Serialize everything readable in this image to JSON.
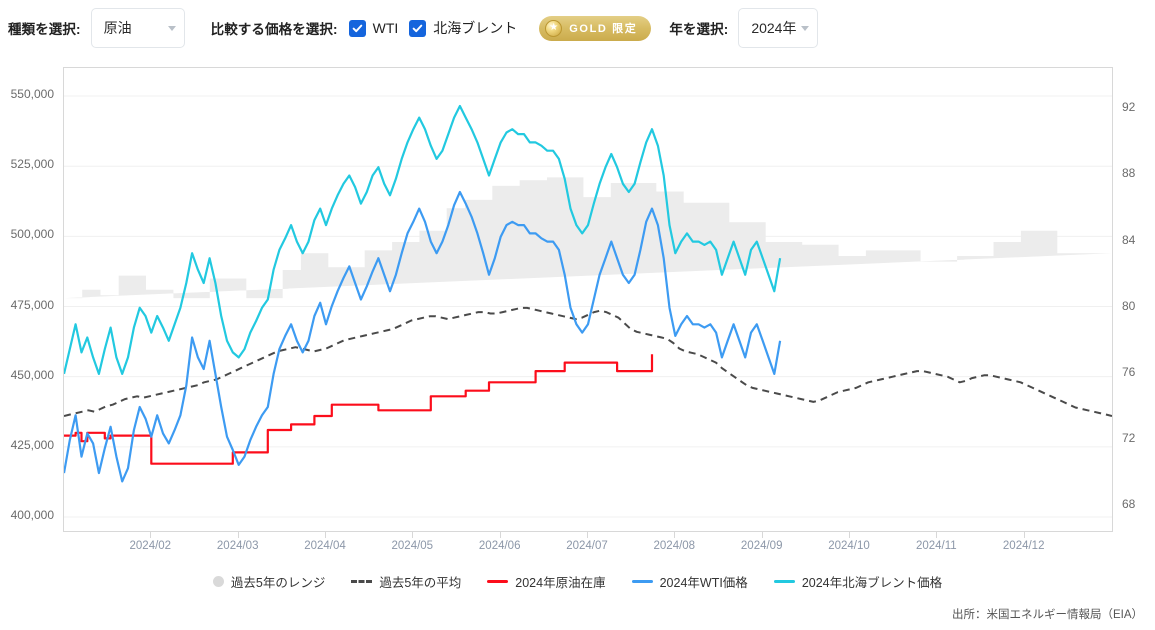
{
  "toolbar": {
    "type_label": "種類を選択:",
    "type_value": "原油",
    "compare_label": "比較する価格を選択:",
    "checkboxes": [
      {
        "label": "WTI",
        "checked": true
      },
      {
        "label": "北海ブレント",
        "checked": true
      }
    ],
    "gold_badge": "GOLD 限定",
    "year_label": "年を選択:",
    "year_value": "2024年",
    "accent_blue": "#1565dd",
    "gold": "#d7bc63"
  },
  "legend": {
    "items": [
      {
        "label": "過去5年のレンジ",
        "marker": "dot",
        "color": "#d9d9d9"
      },
      {
        "label": "過去5年の平均",
        "marker": "dash",
        "color": "#4a4a4a"
      },
      {
        "label": "2024年原油在庫",
        "marker": "line",
        "color": "#fc0d1b"
      },
      {
        "label": "2024年WTI価格",
        "marker": "line",
        "color": "#3d9bf2"
      },
      {
        "label": "2024年北海ブレント価格",
        "marker": "line",
        "color": "#22c9e0"
      }
    ]
  },
  "source": "出所：米国エネルギー情報局（EIA）",
  "chart_data": {
    "type": "line",
    "title": "",
    "xlabel": "",
    "ylabel_left": "",
    "ylabel_right": "",
    "grid": true,
    "legend_position": "bottom",
    "x_ticks": [
      "2024/02",
      "2024/03",
      "2024/04",
      "2024/05",
      "2024/06",
      "2024/07",
      "2024/08",
      "2024/09",
      "2024/10",
      "2024/11",
      "2024/12"
    ],
    "x_tick_positions": [
      0.0833,
      0.1667,
      0.25,
      0.3333,
      0.4167,
      0.5,
      0.5833,
      0.6667,
      0.75,
      0.8333,
      0.9167
    ],
    "y_left_ticks": [
      400000,
      425000,
      450000,
      475000,
      500000,
      525000,
      550000
    ],
    "y_left_lim": [
      395000,
      560000
    ],
    "y_right_ticks": [
      68,
      72,
      76,
      80,
      84,
      88,
      92
    ],
    "y_right_lim": [
      66.5,
      94.5
    ],
    "series": [
      {
        "name": "過去5年のレンジ",
        "type": "area_band",
        "axis": "left",
        "color": "#ececec",
        "upper": [
          478000,
          478000,
          481000,
          481000,
          479000,
          479000,
          486000,
          486000,
          486000,
          481000,
          481000,
          481000,
          478000,
          478000,
          478000,
          478000,
          485000,
          485000,
          485000,
          485000,
          478000,
          478000,
          478000,
          478000,
          488000,
          488000,
          494000,
          494000,
          494000,
          489000,
          489000,
          489000,
          489000,
          495000,
          495000,
          495000,
          498000,
          498000,
          498000,
          502000,
          502000,
          502000,
          510000,
          510000,
          513000,
          513000,
          513000,
          518000,
          518000,
          518000,
          520000,
          520000,
          520000,
          521000,
          521000,
          521000,
          521000,
          514000,
          514000,
          514000,
          519000,
          519000,
          519000,
          519000,
          519000,
          516000,
          516000,
          516000,
          512000,
          512000,
          512000,
          512000,
          512000,
          505000,
          505000,
          505000,
          505000,
          498000,
          498000,
          498000,
          498000,
          497000,
          497000,
          497000,
          497000,
          493000,
          493000,
          493000,
          495000,
          495000,
          495000,
          495000,
          495000,
          495000,
          491000,
          491000,
          491000,
          491000,
          493000,
          493000,
          493000,
          493000,
          498000,
          498000,
          498000,
          502000,
          502000,
          502000,
          502000,
          494000,
          494000,
          494000,
          494000,
          494000,
          494000,
          494000
        ],
        "lower": [
          410000,
          410000,
          413000,
          413000,
          413000,
          409000,
          409000,
          409000,
          409000,
          413000,
          413000,
          413000,
          406000,
          406000,
          406000,
          406000,
          404000,
          404000,
          404000,
          404000,
          409000,
          409000,
          409000,
          409000,
          409000,
          409000,
          409000,
          409000,
          404000,
          404000,
          404000,
          404000,
          404000,
          404000,
          404000,
          404000,
          406000,
          406000,
          406000,
          406000,
          409000,
          409000,
          409000,
          406000,
          406000,
          406000,
          406000,
          409000,
          409000,
          409000,
          409000,
          409000,
          409000,
          409000,
          404000,
          404000,
          404000,
          404000,
          409000,
          409000,
          409000,
          409000,
          412000,
          412000,
          412000,
          412000,
          404000,
          404000,
          404000,
          404000,
          404000,
          412000,
          412000,
          412000,
          412000,
          412000,
          412000,
          412000,
          409000,
          409000,
          409000,
          412000,
          412000,
          412000,
          418000,
          418000,
          418000,
          418000,
          418000,
          418000,
          418000,
          418000,
          412000,
          412000,
          412000,
          412000,
          418000,
          418000,
          418000,
          412000,
          412000,
          412000,
          409000,
          409000,
          409000,
          409000,
          412000,
          412000,
          412000,
          412000,
          412000,
          409000,
          409000,
          409000,
          409000
        ]
      },
      {
        "name": "過去5年の平均",
        "type": "line",
        "style": "dashed",
        "axis": "left",
        "color": "#4a4a4a",
        "values": [
          436000,
          436500,
          437000,
          437500,
          438000,
          437500,
          438500,
          439500,
          440000,
          441000,
          442000,
          442500,
          443000,
          442500,
          443000,
          443500,
          444000,
          444500,
          445000,
          445500,
          446000,
          446500,
          447000,
          448000,
          448500,
          449000,
          450000,
          451000,
          452000,
          453000,
          454000,
          455000,
          456000,
          457000,
          458000,
          459000,
          459500,
          460000,
          460500,
          460000,
          459500,
          459000,
          459500,
          460000,
          461000,
          462000,
          463000,
          463500,
          464000,
          464500,
          465000,
          465500,
          466000,
          466500,
          467000,
          468000,
          469000,
          470000,
          470500,
          471000,
          471500,
          471500,
          471000,
          470500,
          471000,
          471500,
          472000,
          472500,
          473000,
          473000,
          472500,
          472500,
          473000,
          473500,
          474000,
          474500,
          474500,
          474000,
          473500,
          473000,
          472500,
          472000,
          471500,
          471000,
          470500,
          471000,
          472000,
          473000,
          473500,
          473000,
          472000,
          471000,
          469000,
          467000,
          466000,
          465500,
          465000,
          464500,
          464000,
          463500,
          462000,
          460000,
          459000,
          458500,
          458000,
          457000,
          456000,
          455000,
          453000,
          451500,
          450000,
          448500,
          447000,
          446000,
          445500,
          445000,
          444500,
          444000,
          443500,
          443000,
          442500,
          442000,
          441500,
          441000,
          441500,
          442500,
          443500,
          444500,
          445000,
          445500,
          446000,
          447000,
          448000,
          448500,
          449000,
          449500,
          450000,
          450500,
          451000,
          451500,
          452000,
          452000,
          451500,
          451000,
          450500,
          450000,
          449000,
          448000,
          448500,
          449500,
          450000,
          450500,
          450500,
          450000,
          449500,
          449000,
          448500,
          448000,
          447000,
          446000,
          445000,
          444000,
          443000,
          442000,
          441000,
          440000,
          439000,
          438500,
          438000,
          437500,
          437000,
          436500,
          436000
        ]
      },
      {
        "name": "2024年原油在庫",
        "type": "line",
        "style": "step",
        "axis": "left",
        "color": "#fc0d1b",
        "values": [
          429000,
          429000,
          430000,
          427000,
          430000,
          430000,
          430000,
          428000,
          429000,
          429000,
          429000,
          429000,
          429000,
          429000,
          429000,
          419000,
          419000,
          419000,
          419000,
          419000,
          419000,
          419000,
          419000,
          419000,
          419000,
          419000,
          419000,
          419000,
          419000,
          423000,
          423000,
          423000,
          423000,
          423000,
          423000,
          431000,
          431000,
          431000,
          431000,
          433000,
          433000,
          433000,
          433000,
          436000,
          436000,
          436000,
          440000,
          440000,
          440000,
          440000,
          440000,
          440000,
          440000,
          440000,
          438000,
          438000,
          438000,
          438000,
          438000,
          438000,
          438000,
          438000,
          438000,
          443000,
          443000,
          443000,
          443000,
          443000,
          443000,
          445000,
          445000,
          445000,
          445000,
          448000,
          448000,
          448000,
          448000,
          448000,
          448000,
          448000,
          448000,
          452000,
          452000,
          452000,
          452000,
          452000,
          455000,
          455000,
          455000,
          455000,
          455000,
          455000,
          455000,
          455000,
          455000,
          452000,
          452000,
          452000,
          452000,
          452000,
          452000,
          458000
        ]
      },
      {
        "name": "2024年WTI価格",
        "type": "line",
        "axis": "right",
        "color": "#3d9bf2",
        "values": [
          70.0,
          72.0,
          73.5,
          71.0,
          72.4,
          71.8,
          70.0,
          71.5,
          72.8,
          71.0,
          69.5,
          70.3,
          72.6,
          74.0,
          73.3,
          72.2,
          73.5,
          72.4,
          71.8,
          72.6,
          73.5,
          75.3,
          78.2,
          77.0,
          76.3,
          78.0,
          76.0,
          74.0,
          72.2,
          71.4,
          70.5,
          71.0,
          72.0,
          72.8,
          73.5,
          74.0,
          76.0,
          77.5,
          78.3,
          79.0,
          78.0,
          77.3,
          78.0,
          79.5,
          80.3,
          79.0,
          80.1,
          81.0,
          81.8,
          82.5,
          81.5,
          80.5,
          81.3,
          82.2,
          83.0,
          82.0,
          81.0,
          82.0,
          83.3,
          84.5,
          85.2,
          86.0,
          85.2,
          84.0,
          83.3,
          84.0,
          85.0,
          86.2,
          87.0,
          86.3,
          85.5,
          84.5,
          83.3,
          82.0,
          83.0,
          84.3,
          85.0,
          85.2,
          85.0,
          85.0,
          84.5,
          84.5,
          84.2,
          84.0,
          84.0,
          83.5,
          82.0,
          80.0,
          79.0,
          78.5,
          79.0,
          80.5,
          82.0,
          83.0,
          84.0,
          83.0,
          82.0,
          81.5,
          82.0,
          83.5,
          85.2,
          86.0,
          85.0,
          83.0,
          80.0,
          78.3,
          79.0,
          79.5,
          79.0,
          79.0,
          78.8,
          79.0,
          78.5,
          77.0,
          78.0,
          79.0,
          78.0,
          77.0,
          78.5,
          79.0,
          78.0,
          77.0,
          76.0,
          78.0
        ]
      },
      {
        "name": "2024年北海ブレント価格",
        "type": "line",
        "axis": "right",
        "color": "#22c9e0",
        "values": [
          76.0,
          77.5,
          79.0,
          77.3,
          78.2,
          77.0,
          76.0,
          77.5,
          78.8,
          77.0,
          76.0,
          77.0,
          78.8,
          80.0,
          79.5,
          78.5,
          79.5,
          78.8,
          78.0,
          79.0,
          80.0,
          81.5,
          83.3,
          82.3,
          81.5,
          83.0,
          81.5,
          79.5,
          78.0,
          77.3,
          77.0,
          77.5,
          78.5,
          79.2,
          80.0,
          80.5,
          82.3,
          83.5,
          84.2,
          85.0,
          84.0,
          83.3,
          84.0,
          85.3,
          86.0,
          85.0,
          86.0,
          86.8,
          87.5,
          88.0,
          87.3,
          86.3,
          87.0,
          88.0,
          88.5,
          87.5,
          86.8,
          87.8,
          89.0,
          90.0,
          90.8,
          91.5,
          90.8,
          89.8,
          89.0,
          89.5,
          90.5,
          91.5,
          92.2,
          91.5,
          90.8,
          90.0,
          89.0,
          88.0,
          89.0,
          90.0,
          90.6,
          90.8,
          90.5,
          90.5,
          90.0,
          90.0,
          89.8,
          89.5,
          89.5,
          89.0,
          87.8,
          86.0,
          85.0,
          84.5,
          85.0,
          86.3,
          87.5,
          88.5,
          89.3,
          88.5,
          87.5,
          87.0,
          87.5,
          88.8,
          90.0,
          90.8,
          89.8,
          88.0,
          85.0,
          83.3,
          84.0,
          84.5,
          84.0,
          84.0,
          83.8,
          84.0,
          83.5,
          82.0,
          83.0,
          84.0,
          83.0,
          82.0,
          83.5,
          84.0,
          83.0,
          82.0,
          81.0,
          83.0
        ]
      }
    ]
  }
}
